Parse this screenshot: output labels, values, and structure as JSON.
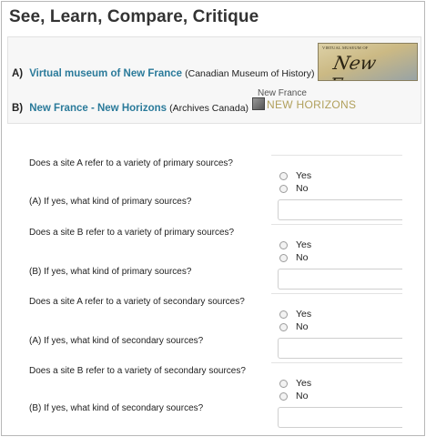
{
  "page": {
    "title": "See, Learn, Compare, Critique"
  },
  "sites": {
    "a": {
      "key": "A)",
      "link": "Virtual museum of New France",
      "source": "(Canadian Museum of History)"
    },
    "b": {
      "key": "B)",
      "link": "New France - New Horizons",
      "source": "(Archives Canada)"
    }
  },
  "logos": {
    "new_france": {
      "small_text": "VIRTUAL MUSEUM OF",
      "script_text": "New France"
    },
    "new_horizons": {
      "top_text": "New France",
      "bottom_text": "NEW HORIZONS"
    }
  },
  "questions": [
    {
      "question": "Does a site A refer to a variety of primary sources?",
      "yes": "Yes",
      "no": "No",
      "followup": "(A) If yes, what kind of primary sources?"
    },
    {
      "question": "Does a site B refer to a variety of primary sources?",
      "yes": "Yes",
      "no": "No",
      "followup": "(B) If yes, what kind of primary sources?"
    },
    {
      "question": "Does a site A refer to a variety of secondary sources?",
      "yes": "Yes",
      "no": "No",
      "followup": "(A) If yes, what kind of secondary sources?"
    },
    {
      "question": "Does a site B refer to a variety of secondary sources?",
      "yes": "Yes",
      "no": "No",
      "followup": "(B) If yes, what kind of secondary sources?"
    }
  ]
}
